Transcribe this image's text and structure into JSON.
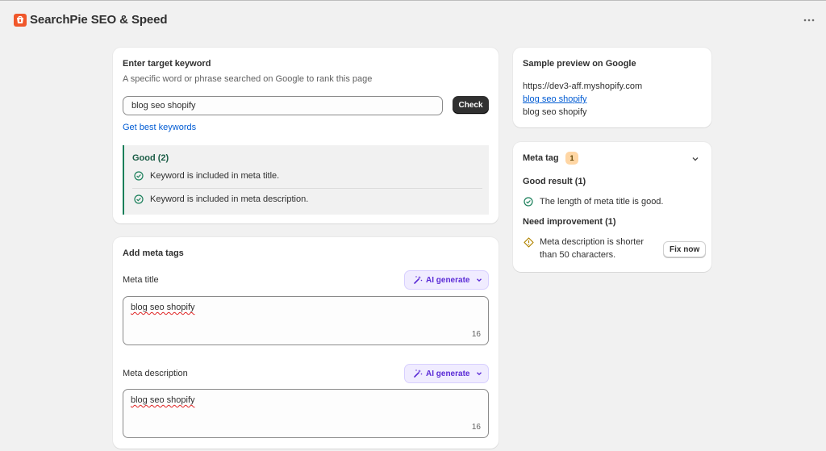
{
  "app": {
    "title": "SearchPie SEO & Speed",
    "more_label": "···"
  },
  "keyword_card": {
    "title": "Enter target keyword",
    "subtitle": "A specific word or phrase searched on Google to rank this page",
    "input_value": "blog seo shopify",
    "check_label": "Check",
    "best_keywords_link": "Get best keywords",
    "good_heading": "Good (2)",
    "good_items": [
      "Keyword is included in meta title.",
      "Keyword is included in meta description."
    ]
  },
  "meta_card": {
    "title": "Add meta tags",
    "meta_title_label": "Meta title",
    "meta_title_value": "blog seo shopify",
    "meta_title_count": "16",
    "meta_description_label": "Meta description",
    "meta_description_value": "blog seo shopify",
    "meta_description_count": "16",
    "ai_generate_label": "AI generate"
  },
  "preview_card": {
    "title": "Sample preview on Google",
    "url": "https://dev3-aff.myshopify.com",
    "link_title": "blog seo shopify",
    "description": "blog seo shopify"
  },
  "meta_tag_card": {
    "title": "Meta tag",
    "badge_count": "1",
    "good_heading": "Good result (1)",
    "good_item": "The length of meta title is good.",
    "improve_heading": "Need improvement (1)",
    "improve_item_line1": "Meta description is shorter",
    "improve_item_line2": "than 50 characters.",
    "fix_label": "Fix now"
  },
  "colors": {
    "brand": "#f0572b",
    "success": "#1a7f5a",
    "warning": "#b28400",
    "link": "#005bd3",
    "ai_accent": "#5b2bd6"
  },
  "icons": [
    "app-logo-icon",
    "more-icon",
    "check-circle-icon",
    "ai-wand-icon",
    "chevron-down-icon",
    "warning-diamond-icon"
  ]
}
